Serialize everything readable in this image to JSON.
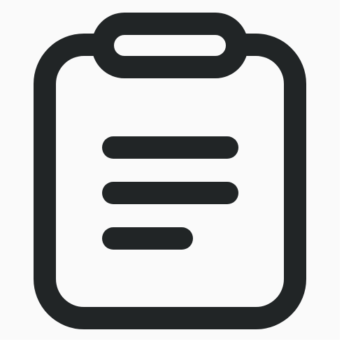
{
  "icon": {
    "name": "clipboard-list-icon",
    "colors": {
      "stroke": "#212526",
      "tile_background": "#fafafa",
      "page_background": "#ffffff"
    },
    "text_line_count": 3
  }
}
